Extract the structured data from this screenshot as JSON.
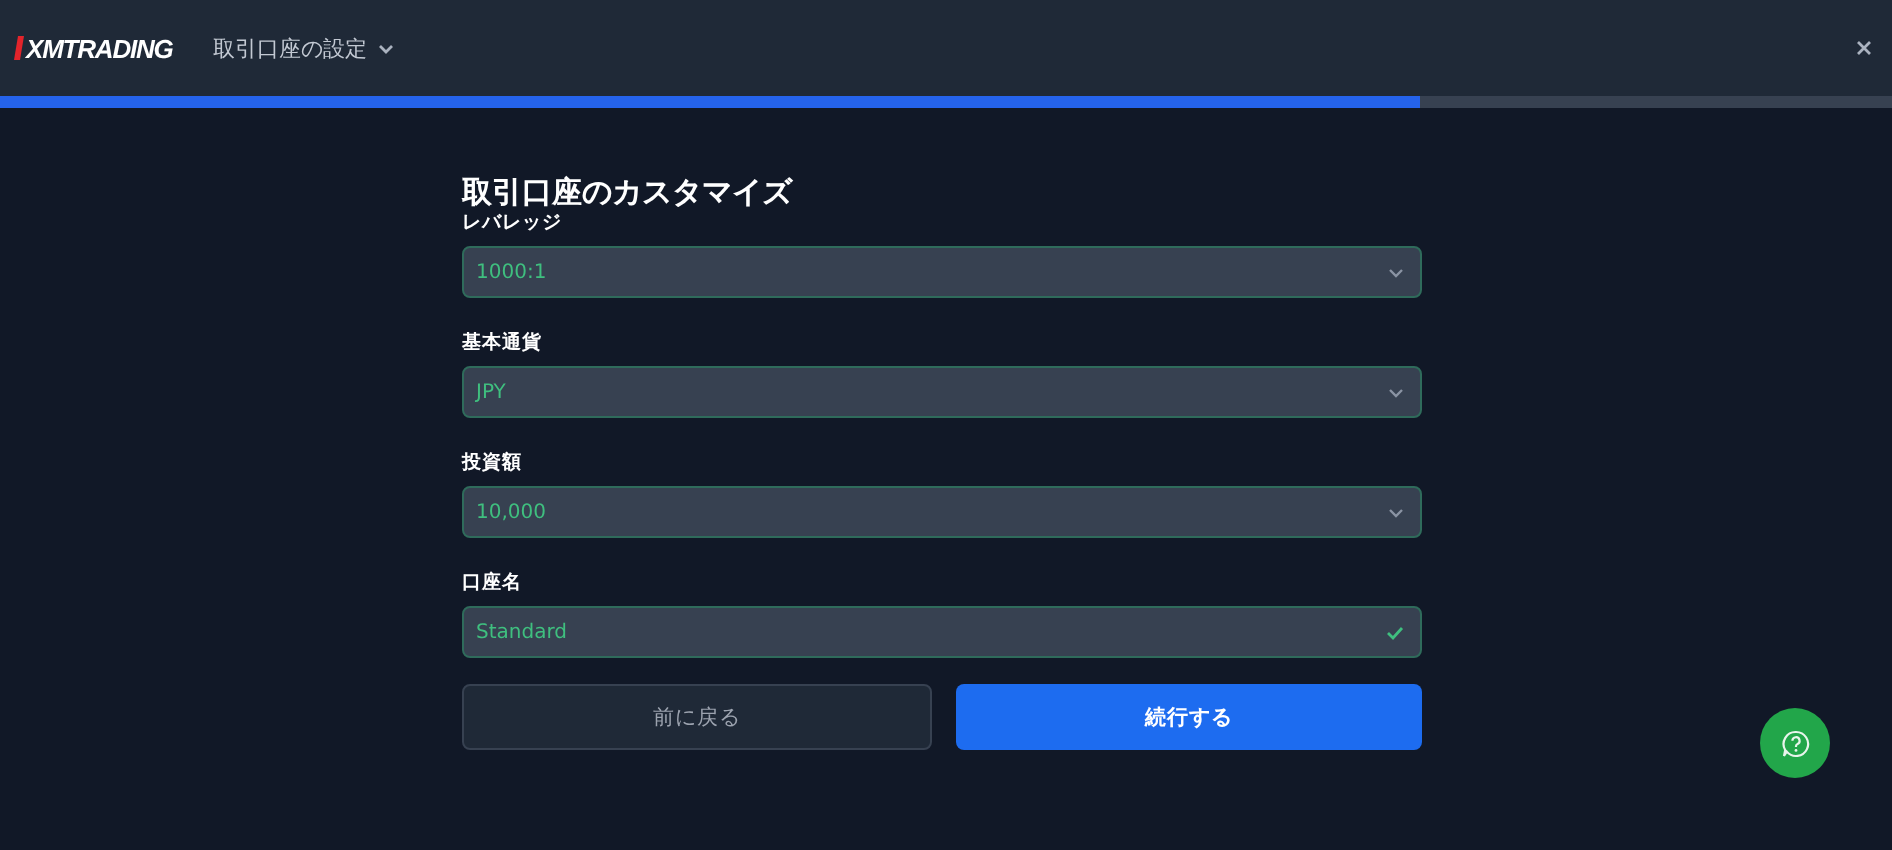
{
  "header": {
    "logo": "XMTRADING",
    "menu": "取引口座の設定",
    "progress": {
      "level": 0.75
    }
  },
  "form": {
    "title": "取引口座のカスタマイズ",
    "fields": [
      {
        "label": "レバレッジ",
        "value": "1000:1",
        "kind": "select"
      },
      {
        "label": "基本通貨",
        "value": "JPY",
        "kind": "select"
      },
      {
        "label": "投資額",
        "value": "10,000",
        "kind": "select"
      },
      {
        "label": "口座名",
        "value": "Standard",
        "kind": "valid"
      }
    ],
    "buttons": [
      {
        "label": "前に戻る",
        "kind": "secondary"
      },
      {
        "label": "続行する",
        "kind": "primary"
      }
    ]
  }
}
